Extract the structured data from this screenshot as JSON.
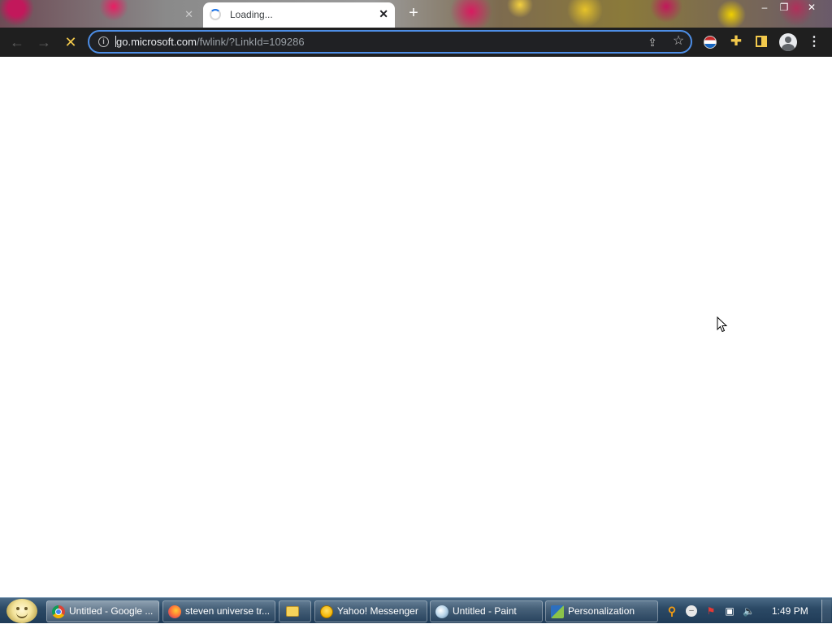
{
  "browser": {
    "tabs": [
      {
        "title": "",
        "state": "inactive"
      },
      {
        "title": "Loading...",
        "state": "active"
      }
    ],
    "icons": {
      "new_tab": "+",
      "tab_close": "✕",
      "minimize": "–",
      "maximize": "❐",
      "close": "✕",
      "back": "←",
      "forward": "→",
      "stop": "✕",
      "info": "i",
      "share": "⇪",
      "bookmark": "☆",
      "extensions": "✚",
      "menu": "⋮"
    },
    "address_bar": {
      "host": "go.microsoft.com",
      "path": "/fwlink/?LinkId=109286"
    },
    "colors": {
      "toolbar": "#1f1f1f",
      "omnibox_focus": "#4d8ee6",
      "accent_yellow": "#f2c94c"
    }
  },
  "taskbar": {
    "buttons": [
      {
        "label": "Untitled - Google ...",
        "icon": "chrome-icon",
        "active": true
      },
      {
        "label": "steven universe tr...",
        "icon": "firefox-icon",
        "active": false
      },
      {
        "label": "",
        "icon": "folder-icon",
        "active": false
      },
      {
        "label": "Yahoo! Messenger",
        "icon": "yahoo-messenger-icon",
        "active": false
      },
      {
        "label": "Untitled - Paint",
        "icon": "paint-icon",
        "active": false
      },
      {
        "label": "Personalization",
        "icon": "personalization-icon",
        "active": false
      }
    ],
    "tray_icons": [
      "search-icon",
      "status-icon",
      "flag-icon",
      "network-icon",
      "volume-icon"
    ],
    "tray_glyphs": {
      "search": "⚲",
      "status": "–",
      "flag": "⚑",
      "network": "▣",
      "volume": "🔈"
    },
    "clock": "1:49 PM"
  }
}
